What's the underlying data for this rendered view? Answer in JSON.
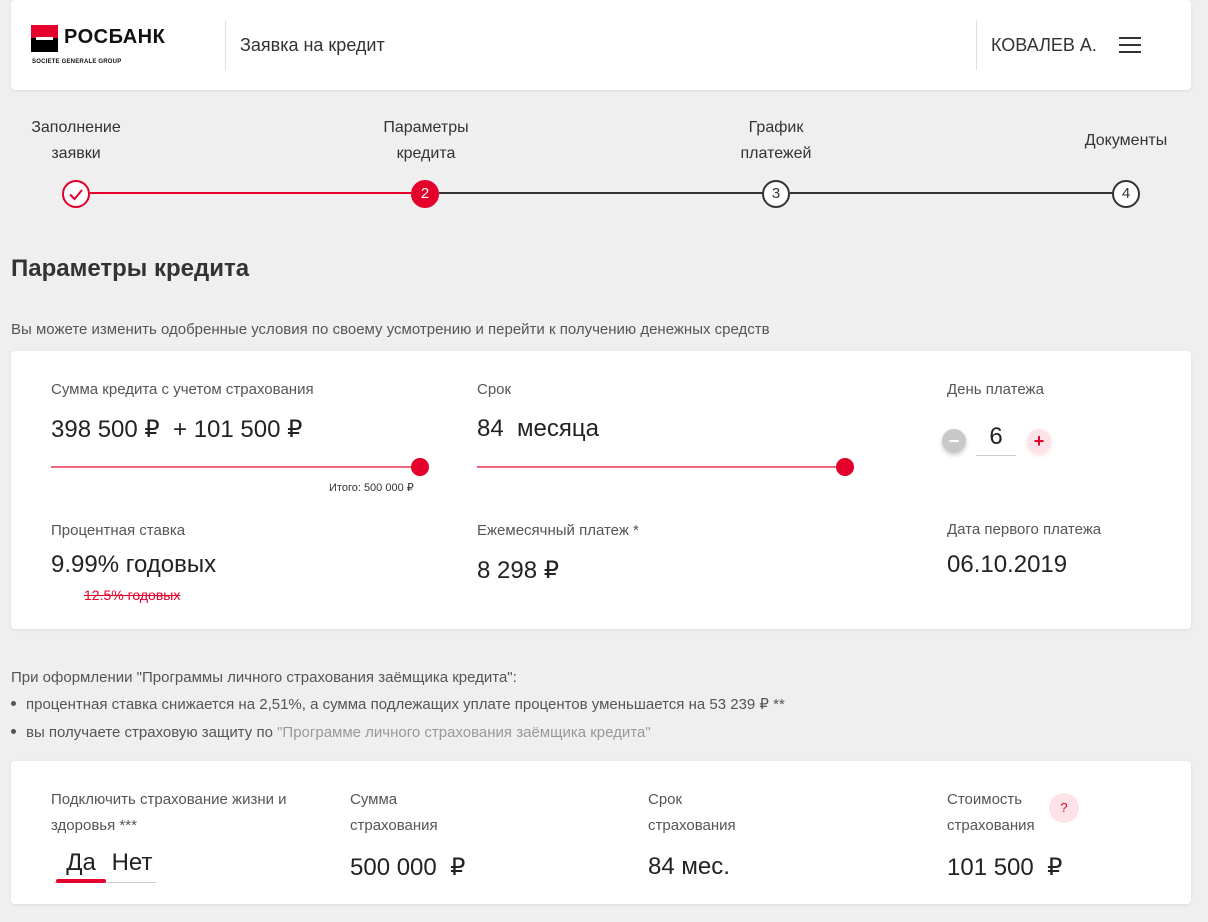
{
  "header": {
    "brand": "РОСБАНК",
    "brand_sub": "SOCIETE GENERALE GROUP",
    "title": "Заявка на кредит",
    "user": "КОВАЛЕВ А."
  },
  "steps": [
    {
      "label": "Заполнение\nзаявки",
      "marker": "✓",
      "state": "done"
    },
    {
      "label": "Параметры\nкредита",
      "marker": "2",
      "state": "active"
    },
    {
      "label": "График\nплатежей",
      "marker": "3",
      "state": "pending"
    },
    {
      "label": "Документы",
      "marker": "4",
      "state": "pending"
    }
  ],
  "page": {
    "title": "Параметры кредита",
    "subtitle": "Вы можете изменить одобренные условия по своему усмотрению и перейти к получению денежных средств"
  },
  "loan": {
    "sum_label": "Сумма кредита с учетом страхования",
    "sum_value": "398 500 ₽  + 101 500 ₽",
    "sum_total": "Итого: 500 000 ₽",
    "term_label": "Срок",
    "term_value": "84  месяца",
    "payday_label": "День платежа",
    "payday_value": "6",
    "payday_minus": "−",
    "payday_plus": "+",
    "rate_label": "Процентная ставка",
    "rate_value": "9.99% годовых",
    "rate_old": "12.5% годовых",
    "monthly_label": "Ежемесячный платеж *",
    "monthly_value": "8 298 ₽",
    "first_date_label": "Дата первого платежа",
    "first_date_value": "06.10.2019"
  },
  "info": {
    "intro": "При оформлении \"Программы личного страхования заёмщика кредита\":",
    "bullet1": "процентная ставка снижается на 2,51%, а сумма подлежащих уплате процентов уменьшается на 53 239 ₽ **",
    "bullet2_prefix": "вы получаете страховую защиту по ",
    "bullet2_link": "\"Программе личного страхования заёмщика кредита\""
  },
  "insurance": {
    "connect_label": "Подключить страхование жизни и здоровья ***",
    "yes": "Да",
    "no": "Нет",
    "sum_label": "Сумма\nстрахования",
    "sum_value": "500 000  ₽",
    "term_label": "Срок\nстрахования",
    "term_value": "84 мес.",
    "cost_label": "Стоимость\nстрахования",
    "cost_value": "101 500  ₽",
    "help": "?"
  },
  "colors": {
    "accent": "#e4002b",
    "background": "#efefef",
    "card": "#ffffff"
  },
  "sliders": {
    "sum_fraction": 1.0,
    "term_fraction": 1.0
  }
}
